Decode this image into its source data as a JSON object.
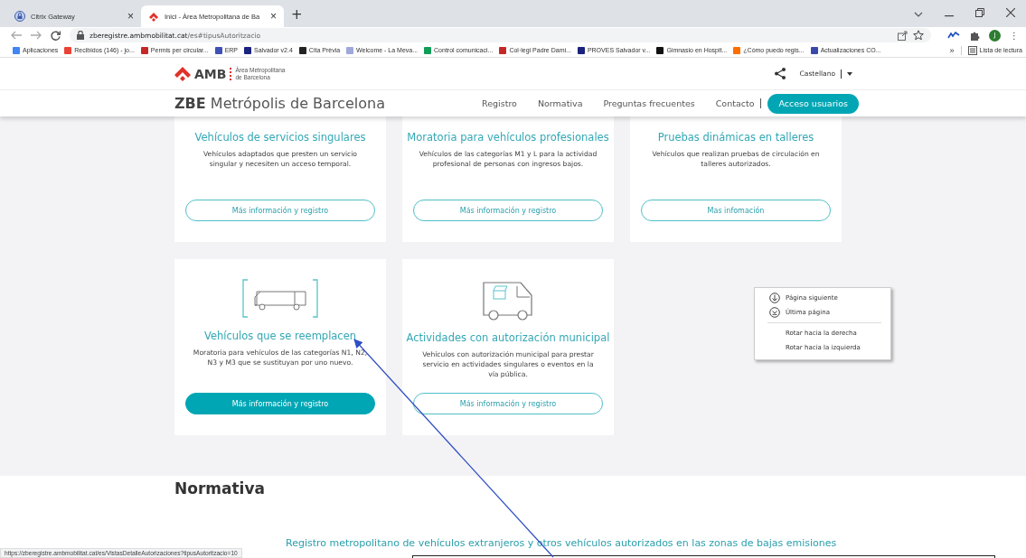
{
  "browser": {
    "tabs": [
      {
        "title": "Citrix Gateway",
        "selected": false
      },
      {
        "title": "Inici - Àrea Metropolitana de Ba",
        "selected": true
      }
    ],
    "address": {
      "host": "zberegistre.ambmobilitat.cat",
      "path": "/es#tipusAutoritzacio"
    },
    "profile_initial": "J",
    "tab_close": "×",
    "new_tab": "+",
    "menu": "⋮",
    "bookmarks": [
      {
        "label": "Aplicaciones",
        "color": "#4285f4"
      },
      {
        "label": "Recibidos (146) - jo...",
        "color": "#ea4335"
      },
      {
        "label": "Permis per circular...",
        "color": "#c62828"
      },
      {
        "label": "ERP",
        "color": "#3f51b5"
      },
      {
        "label": "Salvador v2.4",
        "color": "#1a237e"
      },
      {
        "label": "Cita Prèvia",
        "color": "#222222"
      },
      {
        "label": "Welcome - La Meva...",
        "color": "#9fa8da"
      },
      {
        "label": "Control comunicaci...",
        "color": "#0f9d58"
      },
      {
        "label": "Col·legi Padre Dami...",
        "color": "#c62828"
      },
      {
        "label": "PROVES Salvador v...",
        "color": "#1a237e"
      },
      {
        "label": "Gimnasio en Hospit...",
        "color": "#111111"
      },
      {
        "label": "¿Cómo puedo regis...",
        "color": "#ff6d00"
      },
      {
        "label": "Actualizaciones CO...",
        "color": "#3949ab"
      }
    ],
    "bookmarks_overflow": "»",
    "reading_list": "Lista de lectura"
  },
  "site_header": {
    "logo": "AMB",
    "logo_subtitle": [
      "Àrea Metropolitana",
      "de Barcelona"
    ],
    "language": "Castellano",
    "title": "**ZBE** Metrópolis de Barcelona",
    "nav": [
      "Registro",
      "Normativa",
      "Preguntas frecuentes",
      "Contacto"
    ],
    "cta": "Acceso usuarios"
  },
  "cards": [
    {
      "kind": "none",
      "title": "Vehículos de servicios singulares",
      "description": "Vehículos adaptados que presten un servicio singular y necesiten un acceso temporal.",
      "button": "Más información y registro",
      "filled": false
    },
    {
      "kind": "none",
      "title": "Moratoria para vehículos profesionales",
      "description": "Vehículos de las categorías M1 y L para la actividad profesional de personas con ingresos bajos.",
      "button": "Más información y registro",
      "filled": false
    },
    {
      "kind": "none",
      "title": "Pruebas dinámicas en talleres",
      "description": "Vehículos que realizan pruebas de circulación en talleres autorizados.",
      "button": "Mas infomación",
      "filled": false
    },
    {
      "kind": "truck",
      "title": "Vehículos que se reemplacen",
      "description": "Moratoria para vehículos de las categorías N1, N2, N3 y M3 que se sustituyan por uno nuevo.",
      "button": "Más información y registro",
      "filled": true
    },
    {
      "kind": "van",
      "title": "Actividades con autorización municipal",
      "description": "Vehículos con autorización municipal para prestar servicio en actividades singulares o eventos en la vía pública.",
      "button": "Más información y registro",
      "filled": false
    }
  ],
  "context_menu": [
    {
      "kind": "down",
      "label": "Página siguiente"
    },
    {
      "kind": "last",
      "label": "Última página"
    },
    {
      "kind": "separator"
    },
    {
      "kind": "plain",
      "label": "Rotar hacia la derecha"
    },
    {
      "kind": "plain",
      "label": "Rotar hacia la izquierda"
    }
  ],
  "section": {
    "heading": "Normativa",
    "link": "Registro metropolitano de vehículos extranjeros y otros vehículos autorizados en las zonas de bajas emisiones"
  },
  "status_url": "https://zberegistre.ambmobilitat.cat/es/VistasDetalleAutorizaciones?tipusAutoritzacio=10"
}
